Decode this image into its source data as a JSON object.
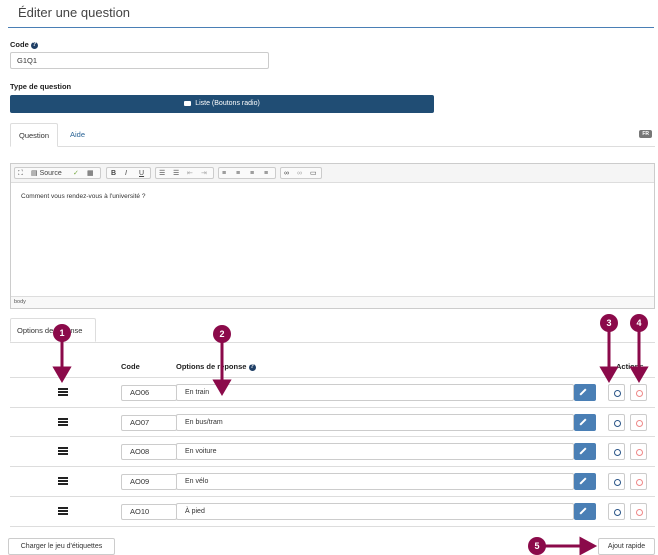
{
  "page": {
    "title": "Éditer une question"
  },
  "code": {
    "label": "Code",
    "value": "G1Q1"
  },
  "question_type": {
    "label": "Type de question",
    "button": "Liste (Boutons radio)"
  },
  "tabs": {
    "question": "Question",
    "help": "Aide",
    "lang": "FR"
  },
  "editor": {
    "toolbar": {
      "source": "Source",
      "bold": "B",
      "italic": "I",
      "underline": "U"
    },
    "content": "Comment vous rendez-vous à l'université ?",
    "status": "body"
  },
  "options": {
    "tab_label": "Options de réponse",
    "columns": {
      "code": "Code",
      "answer": "Options de réponse",
      "actions": "Actions"
    },
    "rows": [
      {
        "code": "AO06",
        "text": "En train"
      },
      {
        "code": "AO07",
        "text": "En bus/tram"
      },
      {
        "code": "AO08",
        "text": "En voiture"
      },
      {
        "code": "AO09",
        "text": "En vélo"
      },
      {
        "code": "AO10",
        "text": "À pied"
      }
    ]
  },
  "buttons": {
    "load_labels": "Charger le jeu d'étiquettes",
    "quick_add": "Ajout rapide"
  },
  "markers": [
    "1",
    "2",
    "3",
    "4",
    "5"
  ],
  "colors": {
    "primary": "#204d74",
    "marker": "#8b0a4a"
  }
}
